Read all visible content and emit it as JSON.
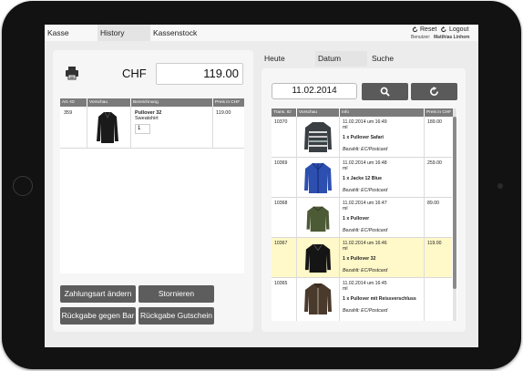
{
  "nav": {
    "tabs": [
      "Kasse",
      "History",
      "Kassenstock"
    ],
    "active_tab": "History"
  },
  "session": {
    "reset": "Reset",
    "logout": "Logout",
    "user_label": "Benutzer:",
    "user_name": "Matthias Linhem"
  },
  "cart": {
    "currency": "CHF",
    "total": "119.00",
    "columns": [
      "Art.-ID",
      "Vorschau",
      "Bezeichnung",
      "Preis in CHF"
    ],
    "items": [
      {
        "id": "359",
        "name": "Pullover 32",
        "category": "Sweatshirt",
        "qty": "1",
        "price": "119.00"
      }
    ]
  },
  "actions": {
    "change_payment": "Zahlungsart ändern",
    "cancel": "Stornieren",
    "return_cash": "Rückgabe gegen Bar",
    "return_voucher": "Rückgabe Gutschein"
  },
  "history": {
    "tabs": [
      "Heute",
      "Datum",
      "Suche"
    ],
    "active_tab": "Datum",
    "date": "11.02.2014",
    "columns": [
      "Trans. ID",
      "Vorschau",
      "Info",
      "Preis in CHF"
    ],
    "rows": [
      {
        "id": "10370",
        "date": "11.02.2014 um 16:49",
        "unit": "ml",
        "item": "1 x Pullover Safari",
        "payment": "Bezahlt: EC/Postcard",
        "price": "189.00",
        "product": "striped-sweater",
        "highlighted": false
      },
      {
        "id": "10369",
        "date": "11.02.2014 um 16:48",
        "unit": "ml",
        "item": "1 x Jacke 12 Blue",
        "payment": "Bezahlt: EC/Postcard",
        "price": "259.00",
        "product": "blue-jacket",
        "highlighted": false
      },
      {
        "id": "10368",
        "date": "11.02.2014 um 16:47",
        "unit": "ml",
        "item": "1 x Pullover",
        "payment": "Bezahlt: EC/Postcard",
        "price": "89.00",
        "product": "olive-sweater",
        "highlighted": false
      },
      {
        "id": "10367",
        "date": "11.02.2014 um 16:46",
        "unit": "ml",
        "item": "1 x Pullover 32",
        "payment": "Bezahlt: EC/Postcard",
        "price": "119.00",
        "product": "black-sweater",
        "highlighted": true
      },
      {
        "id": "10365",
        "date": "11.02.2014 um 16:45",
        "unit": "ml",
        "item": "1 x Pullover mit Reissverschluss",
        "payment": "Bezahlt: EC/Postcard",
        "price": "",
        "product": "brown-hoodie",
        "highlighted": false
      }
    ]
  },
  "colors": {
    "highlight": "#fff8c8",
    "button": "#5d5d5d",
    "header": "#7b7b7b"
  }
}
